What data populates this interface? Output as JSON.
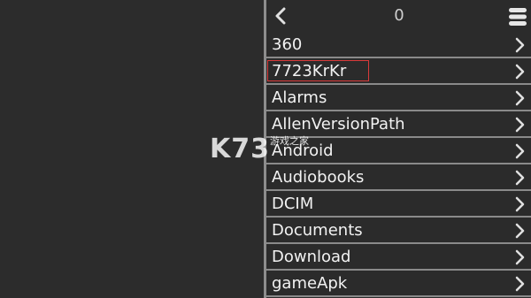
{
  "header": {
    "count": "0",
    "back_icon": "chevron-left-icon",
    "menu_icon": "stack-menu-icon"
  },
  "folders": [
    {
      "label": "360"
    },
    {
      "label": "7723KrKr",
      "selected": true
    },
    {
      "label": "Alarms"
    },
    {
      "label": "AllenVersionPath"
    },
    {
      "label": "Android"
    },
    {
      "label": "Audiobooks"
    },
    {
      "label": "DCIM"
    },
    {
      "label": "Documents"
    },
    {
      "label": "Download"
    },
    {
      "label": "gameApk"
    }
  ],
  "watermark": {
    "logo": "K73",
    "sub": "游戏之家"
  },
  "colors": {
    "background": "#2b2b2b",
    "divider": "#8a8a8a",
    "text": "#f2f2f2",
    "highlight": "#d83a3a"
  }
}
